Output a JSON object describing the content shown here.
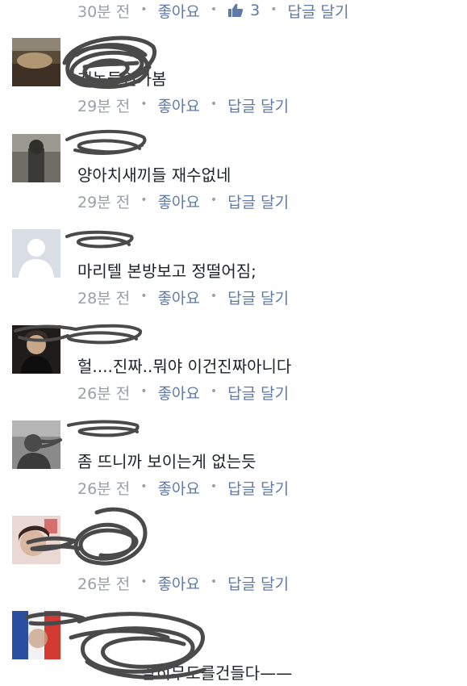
{
  "actions": {
    "like": "좋아요",
    "reply": "답글 달기"
  },
  "comments": [
    {
      "time": "30분 전",
      "like_count": "3"
    },
    {
      "time": "29분 전",
      "text": "개놈들인가봄"
    },
    {
      "time": "29분 전",
      "text": "양아치새끼들 재수없네"
    },
    {
      "time": "28분 전",
      "text": "마리텔 본방보고 정떨어짐;"
    },
    {
      "time": "26분 전",
      "text": "헐....진짜..뭐야 이건진짜아니다"
    },
    {
      "time": "26분 전",
      "text": "좀 뜨니까 보이는게 없는듯"
    },
    {
      "time": "26분 전",
      "text": ""
    },
    {
      "time": "",
      "text": "감히무도를건들다——"
    }
  ],
  "colors": {
    "meta": "#9aa0a8",
    "link": "#5f7aa8",
    "text": "#1d2129",
    "scribble": "#4a4a4a"
  }
}
